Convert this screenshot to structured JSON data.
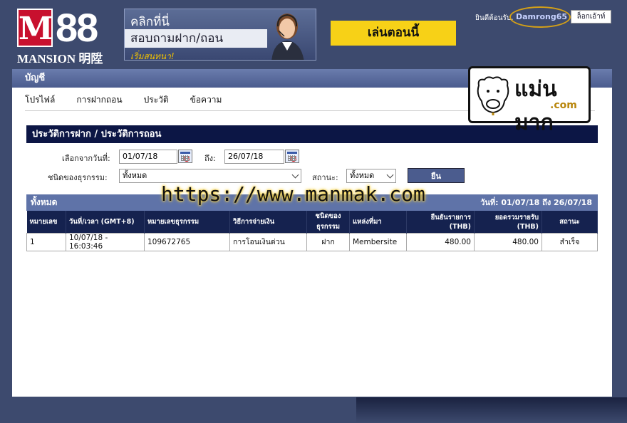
{
  "header": {
    "logo_brand": "M88",
    "logo_sub": "MANSION 明陞",
    "banner_line1": "คลิกที่นี่",
    "banner_line2": "สอบถามฝาก/ถอน",
    "banner_line3": "เริ่มสนทนา!",
    "play_now": "เล่นตอนนี้",
    "welcome": "ยินดีต้อนรับ,",
    "username": "Damrong65",
    "logout": "ล็อกเอ้าท์"
  },
  "panel": {
    "title": "บัญชี",
    "nav": [
      "โปรไฟล์",
      "การฝากถอน",
      "ประวัติ",
      "ข้อความ"
    ],
    "section_title": "ประวัติการฝาก / ประวัติการถอน"
  },
  "filters": {
    "from_label": "เลือกจากวันที่:",
    "from_value": "01/07/18",
    "to_label": "ถึง:",
    "to_value": "26/07/18",
    "type_label": "ชนิดของธุรกรรม:",
    "type_value": "ทั้งหมด",
    "status_label": "สถานะ:",
    "status_value": "ทั้งหมด",
    "submit": "ยืน"
  },
  "results": {
    "label": "ทั้งหมด",
    "range": "วันที่: 01/07/18 ถึง 26/07/18",
    "columns": [
      "หมายเลข",
      "วันที่/เวลา (GMT+8)",
      "หมายเลขธุรกรรม",
      "วิธีการจ่ายเงิน",
      "ชนิดของ ธุรกรรม",
      "แหล่งที่มา",
      "ยืนยันรายการ (THB)",
      "ยอดรวมรายรับ (THB)",
      "สถานะ"
    ],
    "rows": [
      [
        "1",
        "10/07/18 - 16:03:46",
        "109672765",
        "การโอนเงินด่วน",
        "ฝาก",
        "Membersite",
        "480.00",
        "480.00",
        "สำเร็จ"
      ]
    ]
  },
  "watermark": {
    "url": "https://www.manmak.com",
    "logo_text": "แม่นมาก",
    "logo_domain": ".com"
  }
}
